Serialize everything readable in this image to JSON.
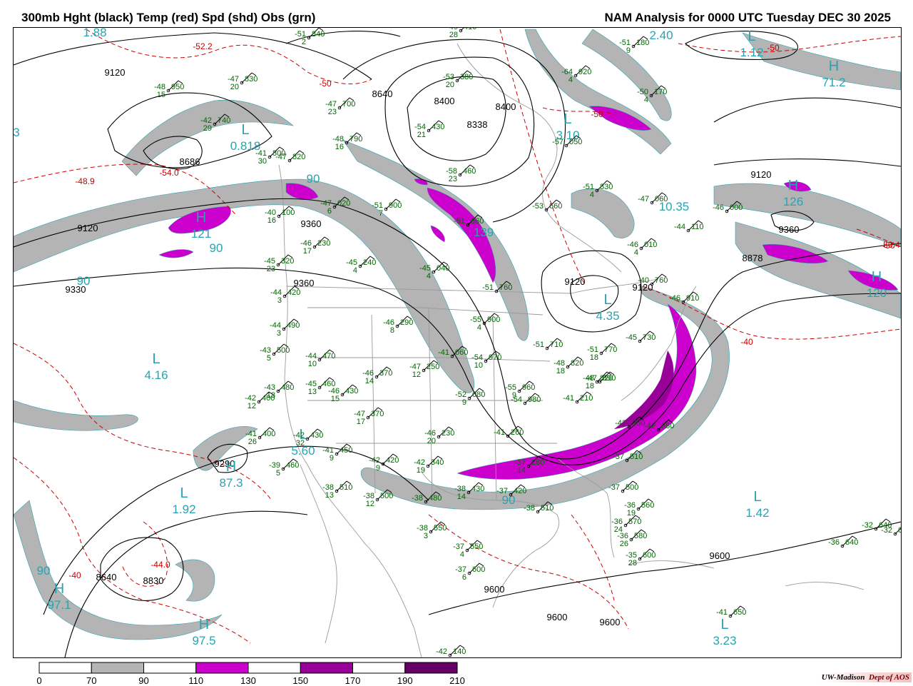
{
  "title_left": "300mb Hght (black) Temp (red) Spd (shd) Obs (grn)",
  "title_right": "NAM Analysis for 0000 UTC Tuesday  DEC 30 2025",
  "credit": {
    "org": "UW-Madison",
    "dept": "Dept of AOS"
  },
  "colors": {
    "height_contour": "#000000",
    "temp_contour": "#cc0000",
    "wind_70_90": "#b4b4b4",
    "wind_110_130": "#cc00cc",
    "wind_150_170": "#990099",
    "wind_190_210": "#660066",
    "obs": "#006600",
    "extrema": "#2aa3b0",
    "geography": "#9a9a9a"
  },
  "legend": {
    "ticks": [
      "0",
      "70",
      "90",
      "110",
      "130",
      "150",
      "170",
      "190",
      "210"
    ],
    "bins": [
      {
        "from": "0",
        "to": "70",
        "color": "#ffffff"
      },
      {
        "from": "70",
        "to": "90",
        "color": "#b4b4b4"
      },
      {
        "from": "90",
        "to": "110",
        "color": "#ffffff"
      },
      {
        "from": "110",
        "to": "130",
        "color": "#cc00cc"
      },
      {
        "from": "130",
        "to": "150",
        "color": "#ffffff"
      },
      {
        "from": "150",
        "to": "170",
        "color": "#990099"
      },
      {
        "from": "170",
        "to": "190",
        "color": "#ffffff"
      },
      {
        "from": "190",
        "to": "210",
        "color": "#660066"
      }
    ]
  },
  "height_labels": [
    "9120",
    "8640",
    "8400",
    "8400",
    "8338",
    "8686",
    "9120",
    "9120",
    "9360",
    "9360",
    "9330",
    "9360",
    "9290",
    "8640",
    "8830",
    "9120",
    "9120",
    "8878",
    "9600",
    "9600",
    "9600",
    "9600"
  ],
  "temp_labels": [
    "-52.2",
    "-50",
    "-50",
    "-50",
    "-50",
    "-48.9",
    "-54.0",
    "-44.0",
    "-40",
    "-40",
    "-50.4"
  ],
  "extrema_labels": [
    {
      "sym": "",
      "val": "1.88"
    },
    {
      "sym": "",
      "val": "3"
    },
    {
      "sym": "L",
      "val": "0.818"
    },
    {
      "sym": "L",
      "val": "3.10"
    },
    {
      "sym": "",
      "val": "2.40"
    },
    {
      "sym": "L",
      "val": "1.12"
    },
    {
      "sym": "H",
      "val": "71.2"
    },
    {
      "sym": "H",
      "val": "121"
    },
    {
      "sym": "L",
      "val": "4.16"
    },
    {
      "sym": "L",
      "val": "5.60"
    },
    {
      "sym": "L",
      "val": "1.92"
    },
    {
      "sym": "H",
      "val": "87.3"
    },
    {
      "sym": "H",
      "val": "97.1"
    },
    {
      "sym": "H",
      "val": "97.5"
    },
    {
      "sym": "L",
      "val": "1.42"
    },
    {
      "sym": "L",
      "val": "3.23"
    },
    {
      "sym": "L",
      "val": "4.35"
    },
    {
      "sym": "",
      "val": "10.35"
    },
    {
      "sym": "H",
      "val": "126"
    },
    {
      "sym": "H",
      "val": "120"
    },
    {
      "sym": "",
      "val": "139"
    },
    {
      "sym": "",
      "val": "90"
    },
    {
      "sym": "",
      "val": "90"
    },
    {
      "sym": "",
      "val": "90"
    },
    {
      "sym": "",
      "val": "90"
    },
    {
      "sym": "",
      "val": "90"
    }
  ],
  "observations": [
    {
      "t": "-51",
      "d": "2",
      "h": "840"
    },
    {
      "t": "-48",
      "d": "15",
      "h": "950"
    },
    {
      "t": "-47",
      "d": "20",
      "h": "830"
    },
    {
      "t": "-42",
      "d": "29",
      "h": "740"
    },
    {
      "t": "-47",
      "d": "23",
      "h": "700"
    },
    {
      "t": "-53",
      "d": "20",
      "h": "380"
    },
    {
      "t": "-54",
      "d": "21",
      "h": "430"
    },
    {
      "t": "-49",
      "d": "28",
      "h": "410"
    },
    {
      "t": "-41",
      "d": "30",
      "h": "800"
    },
    {
      "t": "-47",
      "d": "",
      "h": "820"
    },
    {
      "t": "-48",
      "d": "16",
      "h": "790"
    },
    {
      "t": "-58",
      "d": "23",
      "h": "460"
    },
    {
      "t": "-64",
      "d": "4",
      "h": "920"
    },
    {
      "t": "-51",
      "d": "9",
      "h": "180"
    },
    {
      "t": "-50",
      "d": "4",
      "h": "170"
    },
    {
      "t": "-57",
      "d": "",
      "h": "050"
    },
    {
      "t": "-51",
      "d": "4",
      "h": "830"
    },
    {
      "t": "-53",
      "d": "",
      "h": "660"
    },
    {
      "t": "-47",
      "d": "",
      "h": "060"
    },
    {
      "t": "-46",
      "d": "",
      "h": "000"
    },
    {
      "t": "-40",
      "d": "16",
      "h": "100"
    },
    {
      "t": "-47",
      "d": "6",
      "h": "020"
    },
    {
      "t": "-51",
      "d": "7",
      "h": "900"
    },
    {
      "t": "-51",
      "d": "",
      "h": "660"
    },
    {
      "t": "-44",
      "d": "",
      "h": "110"
    },
    {
      "t": "-46",
      "d": "17",
      "h": "230"
    },
    {
      "t": "-46",
      "d": "4",
      "h": "010"
    },
    {
      "t": "-45",
      "d": "23",
      "h": "320"
    },
    {
      "t": "-45",
      "d": "4",
      "h": "240"
    },
    {
      "t": "-45",
      "d": "4",
      "h": "040"
    },
    {
      "t": "-44",
      "d": "3",
      "h": "420"
    },
    {
      "t": "-51",
      "d": "",
      "h": "760"
    },
    {
      "t": "-44",
      "d": "3",
      "h": "490"
    },
    {
      "t": "-46",
      "d": "8",
      "h": "290"
    },
    {
      "t": "-55",
      "d": "4",
      "h": "900"
    },
    {
      "t": "-43",
      "d": "5",
      "h": "500"
    },
    {
      "t": "-44",
      "d": "10",
      "h": "470"
    },
    {
      "t": "-47",
      "d": "12",
      "h": "250"
    },
    {
      "t": "-41",
      "d": "",
      "h": "060"
    },
    {
      "t": "-54",
      "d": "10",
      "h": "970"
    },
    {
      "t": "-51",
      "d": "",
      "h": "710"
    },
    {
      "t": "-46",
      "d": "14",
      "h": "370"
    },
    {
      "t": "-43",
      "d": "13",
      "h": "480"
    },
    {
      "t": "-45",
      "d": "13",
      "h": "460"
    },
    {
      "t": "-42",
      "d": "12",
      "h": "400"
    },
    {
      "t": "-46",
      "d": "15",
      "h": "430"
    },
    {
      "t": "-52",
      "d": "9",
      "h": "080"
    },
    {
      "t": "-55",
      "d": "9",
      "h": "960"
    },
    {
      "t": "-54",
      "d": "",
      "h": "980"
    },
    {
      "t": "-48",
      "d": "18",
      "h": "820"
    },
    {
      "t": "-47",
      "d": "17",
      "h": "370"
    },
    {
      "t": "-41",
      "d": "26",
      "h": "400"
    },
    {
      "t": "-42",
      "d": "32",
      "h": "430"
    },
    {
      "t": "-46",
      "d": "20",
      "h": "230"
    },
    {
      "t": "-41",
      "d": "9",
      "h": "450"
    },
    {
      "t": "-42",
      "d": "9",
      "h": "420"
    },
    {
      "t": "-42",
      "d": "19",
      "h": "340"
    },
    {
      "t": "-39",
      "d": "5",
      "h": "460"
    },
    {
      "t": "-38",
      "d": "13",
      "h": "510"
    },
    {
      "t": "-38",
      "d": "12",
      "h": "500"
    },
    {
      "t": "-38",
      "d": "",
      "h": "480"
    },
    {
      "t": "-37",
      "d": "14",
      "h": "280"
    },
    {
      "t": "-38",
      "d": "14",
      "h": "430"
    },
    {
      "t": "-37",
      "d": "",
      "h": "420"
    },
    {
      "t": "-37",
      "d": "",
      "h": "510"
    },
    {
      "t": "-37",
      "d": "",
      "h": "500"
    },
    {
      "t": "-38",
      "d": "",
      "h": "510"
    },
    {
      "t": "-36",
      "d": "19",
      "h": "560"
    },
    {
      "t": "-36",
      "d": "24",
      "h": "570"
    },
    {
      "t": "-36",
      "d": "26",
      "h": "580"
    },
    {
      "t": "-35",
      "d": "28",
      "h": "600"
    },
    {
      "t": "-38",
      "d": "3",
      "h": "550"
    },
    {
      "t": "-37",
      "d": "4",
      "h": "550"
    },
    {
      "t": "-37",
      "d": "6",
      "h": "600"
    },
    {
      "t": "-32",
      "d": "",
      "h": "640"
    },
    {
      "t": "-32",
      "d": "",
      "h": "6"
    },
    {
      "t": "-36",
      "d": "",
      "h": "640"
    },
    {
      "t": "-41",
      "d": "",
      "h": "650"
    },
    {
      "t": "-42",
      "d": "",
      "h": "140"
    },
    {
      "t": "-46",
      "d": "",
      "h": "910"
    },
    {
      "t": "-40",
      "d": "",
      "h": "760"
    },
    {
      "t": "-45",
      "d": "",
      "h": "730"
    },
    {
      "t": "-51",
      "d": "18",
      "h": "770"
    },
    {
      "t": "-48",
      "d": "18",
      "h": "820"
    },
    {
      "t": "-47",
      "d": "",
      "h": "890"
    },
    {
      "t": "-41",
      "d": "",
      "h": "210"
    },
    {
      "t": "-42",
      "d": "",
      "h": "350"
    },
    {
      "t": "-42",
      "d": "",
      "h": "380"
    },
    {
      "t": "-41",
      "d": "",
      "h": "260"
    }
  ]
}
